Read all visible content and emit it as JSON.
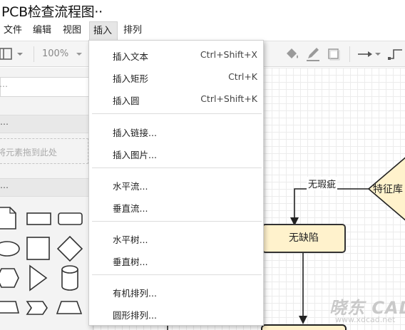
{
  "window": {
    "title": "PCB检查流程图··"
  },
  "menubar": [
    {
      "label": "文件",
      "active": false
    },
    {
      "label": "编辑",
      "active": false
    },
    {
      "label": "视图",
      "active": false
    },
    {
      "label": "插入",
      "active": true
    },
    {
      "label": "排列",
      "active": false
    }
  ],
  "toolbar": {
    "zoom": "100%"
  },
  "sidebar": {
    "section_header_1": "⋯",
    "drop_hint": "将元素拖到此处",
    "section_header_2": "⋯"
  },
  "insert_menu": {
    "groups": [
      [
        {
          "label": "插入文本",
          "shortcut": "Ctrl+Shift+X"
        },
        {
          "label": "插入矩形",
          "shortcut": "Ctrl+K"
        },
        {
          "label": "插入圆",
          "shortcut": "Ctrl+Shift+K"
        }
      ],
      [
        {
          "label": "插入链接...",
          "shortcut": ""
        },
        {
          "label": "插入图片...",
          "shortcut": ""
        }
      ],
      [
        {
          "label": "水平流...",
          "shortcut": ""
        },
        {
          "label": "垂直流...",
          "shortcut": ""
        }
      ],
      [
        {
          "label": "水平树...",
          "shortcut": ""
        },
        {
          "label": "垂直树...",
          "shortcut": ""
        }
      ],
      [
        {
          "label": "有机排列...",
          "shortcut": ""
        },
        {
          "label": "圆形排列...",
          "shortcut": ""
        }
      ]
    ]
  },
  "diagram": {
    "edge_label": "无瑕疵",
    "decision_text": "特征库",
    "node_text": "无缺陷",
    "node_fill": "#fff2cc"
  },
  "watermark": {
    "brand": "晓东 CAD",
    "url": "www.xdcad.net"
  }
}
